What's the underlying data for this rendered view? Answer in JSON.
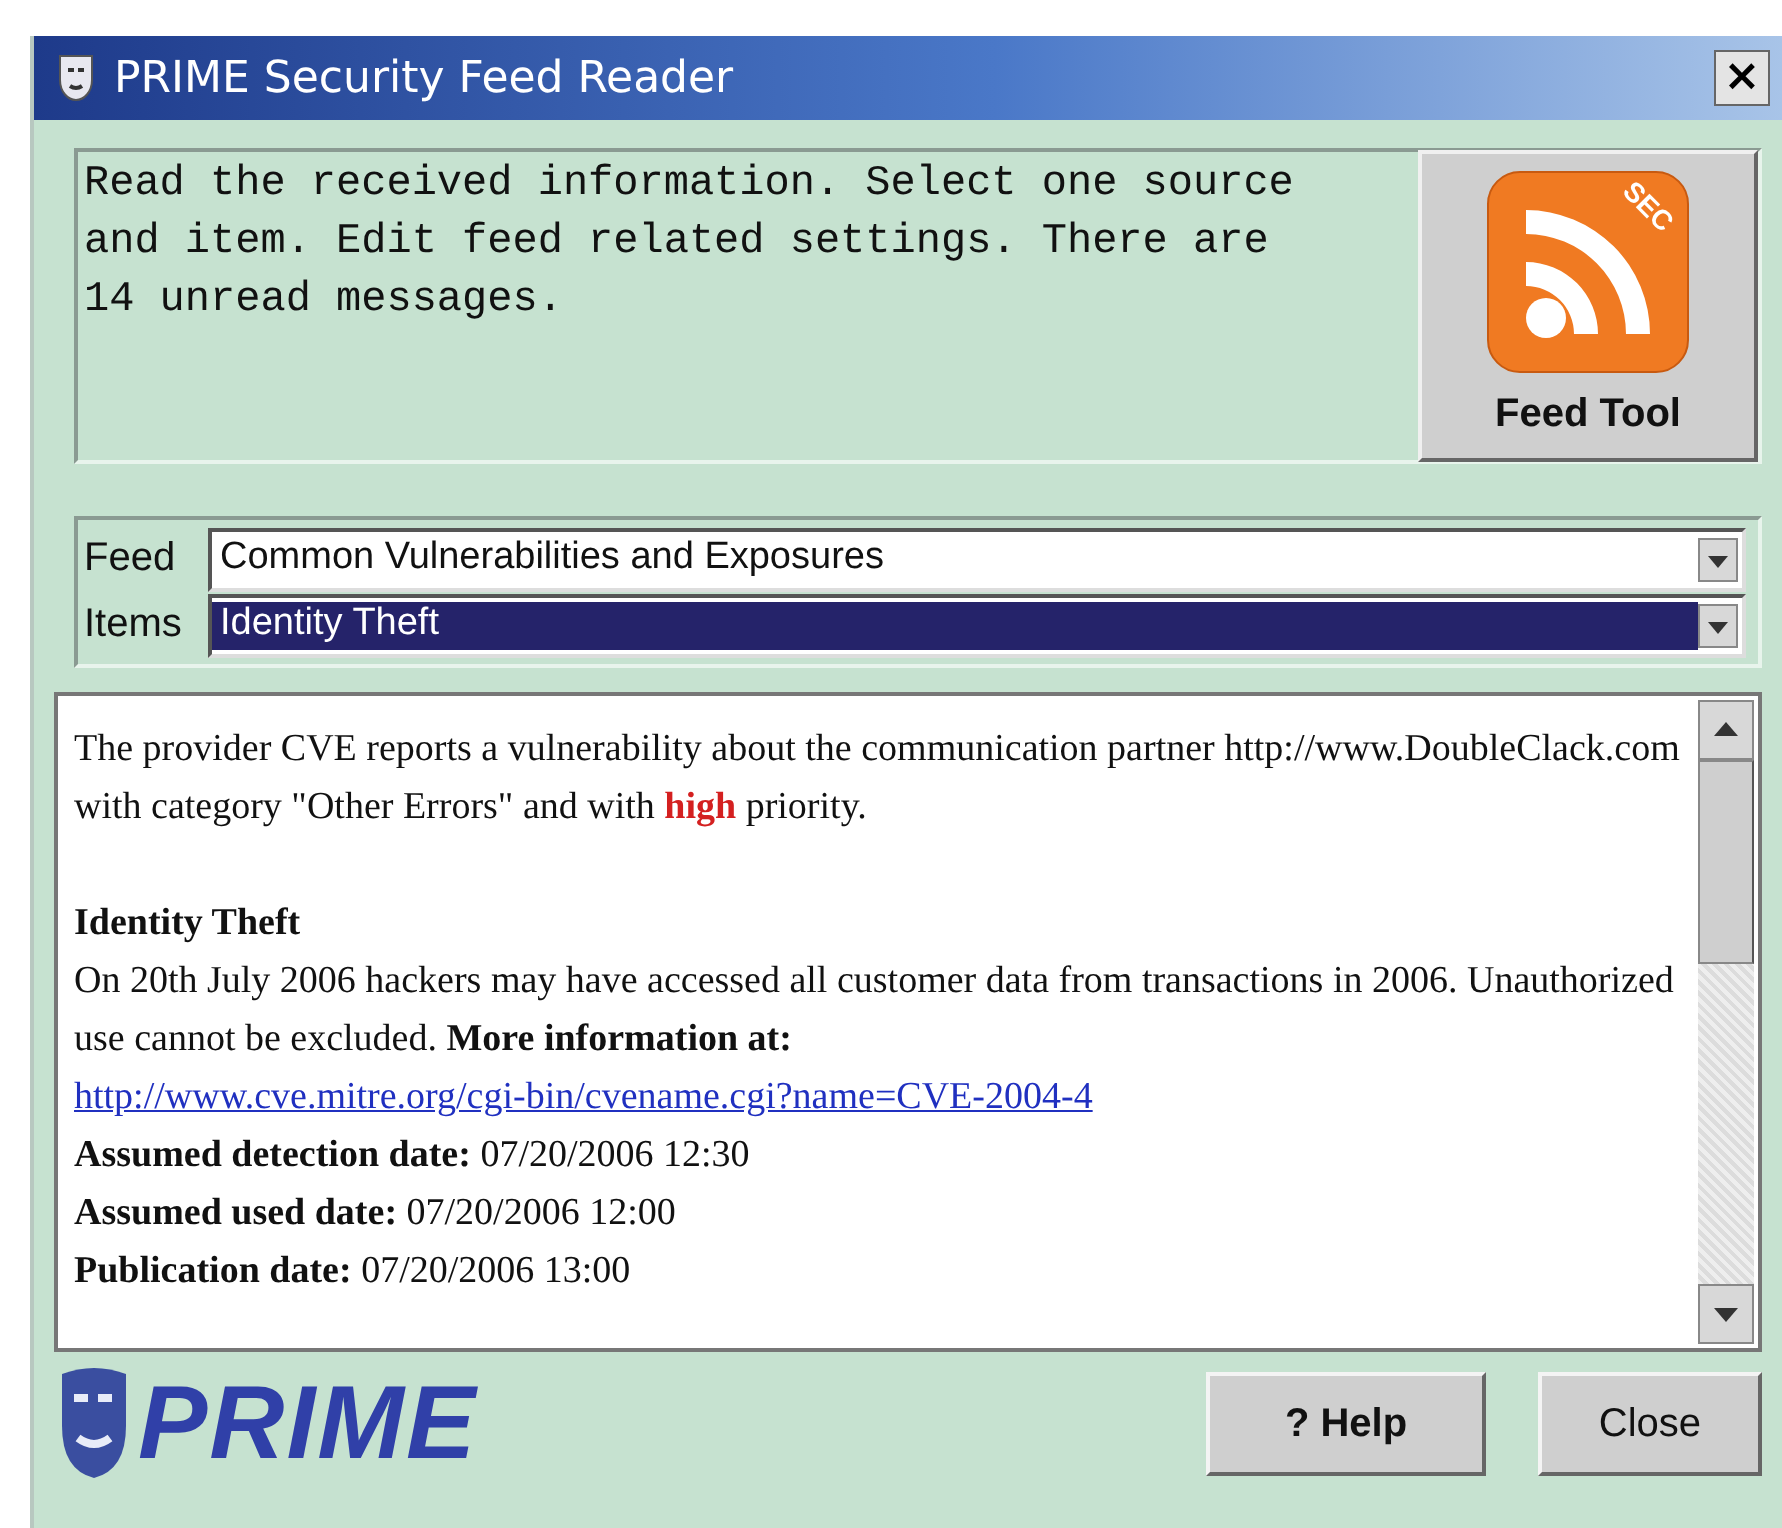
{
  "window": {
    "title": "PRIME Security Feed Reader",
    "close": "×"
  },
  "info": {
    "text": "Read the received information. Select one source and item. Edit feed related settings. There are 14 unread messages.",
    "badge": "SEC",
    "button": "Feed Tool"
  },
  "selectors": [
    {
      "label": "Feed",
      "value": "Common Vulnerabilities and Exposures",
      "selected": false
    },
    {
      "label": "Items",
      "value": "Identity Theft",
      "selected": true
    }
  ],
  "content": [
    {
      "kind": "report",
      "before": "The provider CVE reports a vulnerability about the communication partner http://www.DoubleClack.com with category \"Other Errors\" and with ",
      "priority": "high",
      "after": " priority."
    },
    {
      "kind": "heading",
      "text": "Identity Theft"
    },
    {
      "kind": "paragraph",
      "text": "On 20th July 2006 hackers may have accessed all customer data from transactions in 2006. Unauthorized use cannot be excluded. **More information at:**"
    },
    {
      "kind": "link",
      "text": "http://www.cve.mitre.org/cgi-bin/cvename.cgi?name=CVE-2004-4"
    },
    {
      "kind": "field",
      "label": "Assumed detection date:",
      "value": "07/20/2006 12:30"
    },
    {
      "kind": "field",
      "label": "Assumed used date:",
      "value": "07/20/2006 12:00"
    },
    {
      "kind": "field",
      "label": "Publication date:",
      "value": "07/20/2006 13:00"
    }
  ],
  "footer": {
    "logo": "PRIME",
    "buttons": [
      "? Help",
      "Close"
    ]
  }
}
